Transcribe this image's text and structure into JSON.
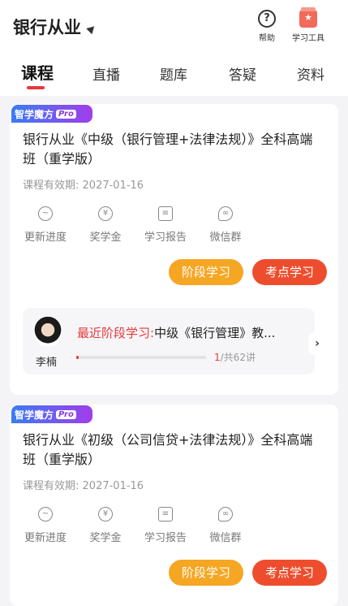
{
  "header": {
    "title": "银行从业",
    "help_label": "帮助",
    "help_glyph": "?",
    "tools_label": "学习工具",
    "tools_glyph": "★"
  },
  "tabs": [
    "课程",
    "直播",
    "题库",
    "答疑",
    "资料"
  ],
  "active_tab": "课程",
  "courses": [
    {
      "badge": "智学魔方",
      "badge_pro": "Pro",
      "title": "银行从业《中级（银行管理+法律法规）》全科高端班（重学版）",
      "validity_label": "课程有效期:",
      "validity_date": "2027-01-16",
      "actions": [
        {
          "label": "更新进度",
          "icon": "trend-icon",
          "glyph": "~"
        },
        {
          "label": "奖学金",
          "icon": "yen-icon",
          "glyph": "¥"
        },
        {
          "label": "学习报告",
          "icon": "report-icon",
          "glyph": "≡"
        },
        {
          "label": "微信群",
          "icon": "wechat-icon",
          "glyph": "∞"
        }
      ],
      "stage_button": "阶段学习",
      "exam_button": "考点学习",
      "recent": {
        "teacher": "李楠",
        "prefix": "最近阶段学习:",
        "lesson": "中级《银行管理》教...",
        "current": "1",
        "total": "/共62讲",
        "progress": 0.016,
        "next_glyph": "›"
      }
    },
    {
      "badge": "智学魔方",
      "badge_pro": "Pro",
      "title": "银行从业《初级（公司信贷+法律法规）》全科高端班（重学版）",
      "validity_label": "课程有效期:",
      "validity_date": "2027-01-16",
      "actions": [
        {
          "label": "更新进度",
          "icon": "trend-icon",
          "glyph": "~"
        },
        {
          "label": "奖学金",
          "icon": "yen-icon",
          "glyph": "¥"
        },
        {
          "label": "学习报告",
          "icon": "report-icon",
          "glyph": "≡"
        },
        {
          "label": "微信群",
          "icon": "wechat-icon",
          "glyph": "∞"
        }
      ],
      "stage_button": "阶段学习",
      "exam_button": "考点学习"
    }
  ],
  "colors": {
    "accent": "#e8383b",
    "stage_button": "#f5a623",
    "exam_button": "#ee4d2d"
  }
}
